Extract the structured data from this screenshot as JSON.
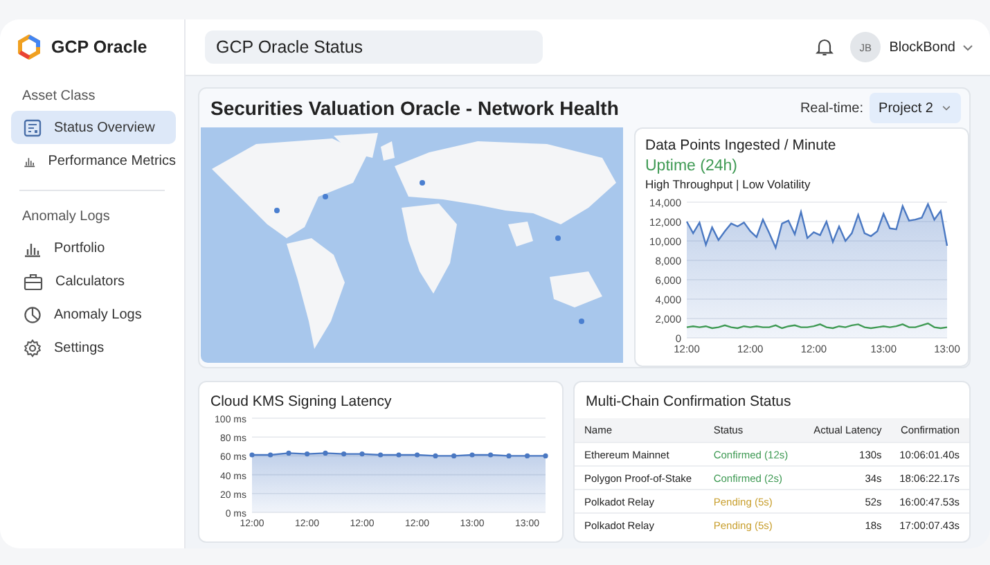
{
  "brand": {
    "name": "GCP Oracle"
  },
  "header": {
    "search": {
      "value": "GCP Oracle Status"
    },
    "user": {
      "initials": "JB",
      "name": "BlockBond"
    }
  },
  "sidebar": {
    "sections": [
      {
        "heading": "Asset Class",
        "items": [
          {
            "label": "Status Overview",
            "selected": true
          },
          {
            "label": "Performance Metrics",
            "selected": false
          }
        ]
      },
      {
        "heading": "Anomaly Logs",
        "items": [
          {
            "label": "Portfolio",
            "selected": false
          },
          {
            "label": "Calculators",
            "selected": false
          },
          {
            "label": "Anomaly Logs",
            "selected": false
          },
          {
            "label": "Settings",
            "selected": false
          }
        ]
      }
    ]
  },
  "health": {
    "title": "Securities Valuation Oracle - Network Health",
    "realtime_label": "Real-time:",
    "project": "Project 2",
    "ingest": {
      "title": "Data Points Ingested / Minute",
      "uptime": "Uptime (24h)",
      "subtitle": "High Throughput | Low Volatility",
      "chart_data": {
        "type": "area",
        "categories": [
          "12:00",
          null,
          null,
          null,
          null,
          null,
          null,
          null,
          null,
          null,
          "12:00",
          null,
          null,
          null,
          null,
          null,
          null,
          null,
          null,
          null,
          "12:00",
          null,
          null,
          null,
          null,
          null,
          null,
          null,
          null,
          null,
          null,
          "13:00",
          null,
          null,
          null,
          null,
          null,
          null,
          null,
          null,
          null,
          "13:00"
        ],
        "series": [
          {
            "color": "#4a78c2",
            "values": [
              12000,
              10800,
              11900,
              9600,
              11400,
              10100,
              11000,
              11800,
              11500,
              11900,
              11000,
              10400,
              12200,
              10800,
              9300,
              11800,
              12100,
              10700,
              13000,
              10300,
              10900,
              10600,
              12000,
              9900,
              11500,
              10000,
              10800,
              12700,
              10800,
              10500,
              11000,
              12800,
              11300,
              11200,
              13600,
              12100,
              12200,
              12400,
              13800,
              12200,
              13100,
              9500
            ]
          },
          {
            "type": "line",
            "color": "#3f9a54",
            "values": [
              1100,
              1200,
              1100,
              1200,
              1000,
              1100,
              1300,
              1100,
              1000,
              1200,
              1100,
              1200,
              1100,
              1100,
              1300,
              1000,
              1200,
              1300,
              1100,
              1100,
              1200,
              1400,
              1100,
              1000,
              1200,
              1100,
              1300,
              1400,
              1100,
              1000,
              1100,
              1200,
              1100,
              1200,
              1400,
              1100,
              1100,
              1300,
              1500,
              1100,
              1000,
              1100
            ]
          }
        ],
        "grid": true,
        "ylim": [
          0,
          14000
        ],
        "yticks": [
          {
            "value": 0,
            "label": "0"
          },
          {
            "value": 2000,
            "label": "2,000"
          },
          {
            "value": 4000,
            "label": "4,000"
          },
          {
            "value": 6000,
            "label": "6,000"
          },
          {
            "value": 8000,
            "label": "8,000"
          },
          {
            "value": 10000,
            "label": "10,000"
          },
          {
            "value": 12000,
            "label": "12,000"
          },
          {
            "value": 14000,
            "label": "14,000"
          }
        ]
      }
    }
  },
  "kms": {
    "title": "Cloud KMS Signing Latency",
    "chart_data": {
      "type": "area",
      "categories": [
        "12:00",
        null,
        null,
        "12:00",
        null,
        null,
        "12:00",
        null,
        null,
        "12:00",
        null,
        null,
        "13:00",
        null,
        null,
        "13:00",
        null
      ],
      "series": [
        {
          "color": "#4a78c2",
          "values": [
            61,
            61,
            63,
            62,
            63,
            62,
            62,
            61,
            61,
            61,
            60,
            60,
            61,
            61,
            60,
            60,
            60
          ]
        }
      ],
      "grid": true,
      "ylim": [
        0,
        100
      ],
      "yticks": [
        {
          "value": 0,
          "label": "0 ms"
        },
        {
          "value": 20,
          "label": "20 ms"
        },
        {
          "value": 40,
          "label": "40 ms"
        },
        {
          "value": 60,
          "label": "60 ms"
        },
        {
          "value": 80,
          "label": "80 ms"
        },
        {
          "value": 100,
          "label": "100 ms"
        }
      ]
    }
  },
  "chains": {
    "title": "Multi-Chain Confirmation Status",
    "columns": [
      "Name",
      "Status",
      "Actual Latency",
      "Confirmation"
    ],
    "rows": [
      {
        "name": "Ethereum Mainnet",
        "status": "Confirmed (12s)",
        "color": "#3f9a54",
        "latency": "130s",
        "confirmation": "10:06:01.40s"
      },
      {
        "name": "Polygon Proof-of-Stake",
        "status": "Confirmed (2s)",
        "color": "#3f9a54",
        "latency": "34s",
        "confirmation": "18:06:22.17s"
      },
      {
        "name": "Polkadot Relay",
        "status": "Pending (5s)",
        "color": "#c9a030",
        "latency": "52s",
        "confirmation": "16:00:47.53s"
      },
      {
        "name": "Polkadot Relay",
        "status": "Pending (5s)",
        "color": "#c9a030",
        "latency": "18s",
        "confirmation": "17:00:07.43s"
      }
    ]
  }
}
